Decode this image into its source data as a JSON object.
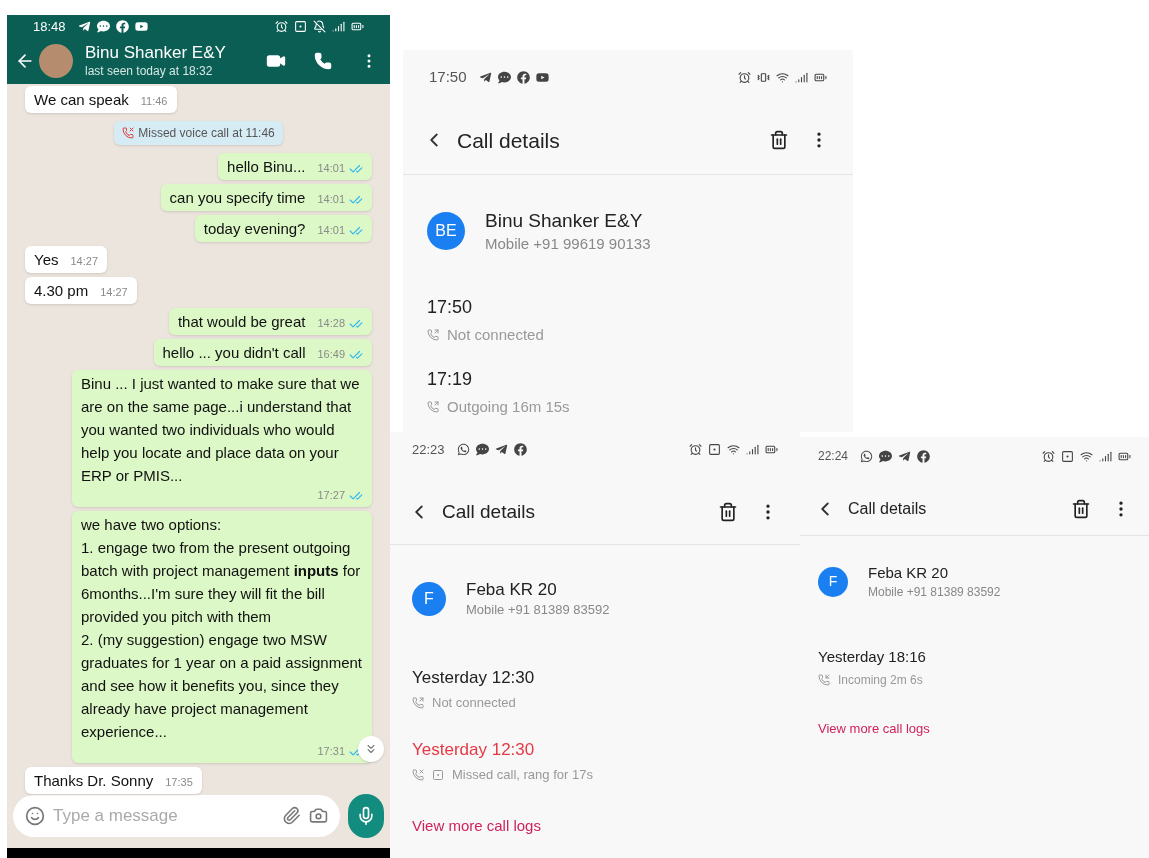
{
  "chat": {
    "status_bar": {
      "time": "18:48"
    },
    "contact": {
      "name": "Binu Shanker E&Y",
      "last_seen": "last seen today at 18:32"
    },
    "messages": [
      {
        "kind": "in",
        "text": "We can speak",
        "time": "11:46"
      },
      {
        "kind": "system",
        "text": "Missed voice call at 11:46"
      },
      {
        "kind": "out",
        "text": "hello Binu...",
        "time": "14:01",
        "read": true
      },
      {
        "kind": "out",
        "text": "can you specify time",
        "time": "14:01",
        "read": true
      },
      {
        "kind": "out",
        "text": "today evening?",
        "time": "14:01",
        "read": true
      },
      {
        "kind": "in",
        "text": "Yes",
        "time": "14:27"
      },
      {
        "kind": "in",
        "text": "4.30 pm",
        "time": "14:27"
      },
      {
        "kind": "out",
        "text": "that would be great",
        "time": "14:28",
        "read": true
      },
      {
        "kind": "out",
        "text": "hello ... you didn't call",
        "time": "16:49",
        "read": true
      },
      {
        "kind": "out",
        "text": "Binu ... I just wanted to make sure that we are on the same page...i understand that you wanted two individuals who would help you locate and place data on your ERP or PMIS...",
        "time": "17:27",
        "read": true
      },
      {
        "kind": "out",
        "text": "we have two options:\n1. engage two from the present outgoing batch with project management **inputs** for 6months...I'm sure they will fit the bill provided you pitch with them\n2. (my suggestion) engage two MSW graduates for 1 year on a paid assignment and see how it benefits you, since they already have project management experience...",
        "time": "17:31",
        "read": true
      },
      {
        "kind": "in",
        "text": "Thanks Dr. Sonny",
        "time": "17:35"
      }
    ],
    "input": {
      "placeholder": "Type a message"
    }
  },
  "call_details": [
    {
      "status_bar": {
        "time": "17:50"
      },
      "title": "Call details",
      "contact": {
        "initials": "BE",
        "name": "Binu Shanker E&Y",
        "number": "Mobile +91 99619 90133"
      },
      "calls": [
        {
          "kind": "outgoing",
          "time": "17:50",
          "detail": "Not connected"
        },
        {
          "kind": "outgoing",
          "time": "17:19",
          "detail": "Outgoing 16m 15s"
        }
      ]
    },
    {
      "status_bar": {
        "time": "22:23"
      },
      "title": "Call details",
      "contact": {
        "initials": "F",
        "name": "Feba KR 20",
        "number": "Mobile +91 81389 83592"
      },
      "calls": [
        {
          "kind": "outgoing",
          "time": "Yesterday 12:30",
          "detail": "Not connected"
        },
        {
          "kind": "missed",
          "time": "Yesterday 12:30",
          "detail": "Missed call, rang for 17s"
        }
      ],
      "link": "View more call logs"
    },
    {
      "status_bar": {
        "time": "22:24"
      },
      "title": "Call details",
      "contact": {
        "initials": "F",
        "name": "Feba KR 20",
        "number": "Mobile +91 81389 83592"
      },
      "calls": [
        {
          "kind": "incoming",
          "time": "Yesterday 18:16",
          "detail": "Incoming 2m 6s"
        }
      ],
      "link": "View more call logs"
    }
  ]
}
